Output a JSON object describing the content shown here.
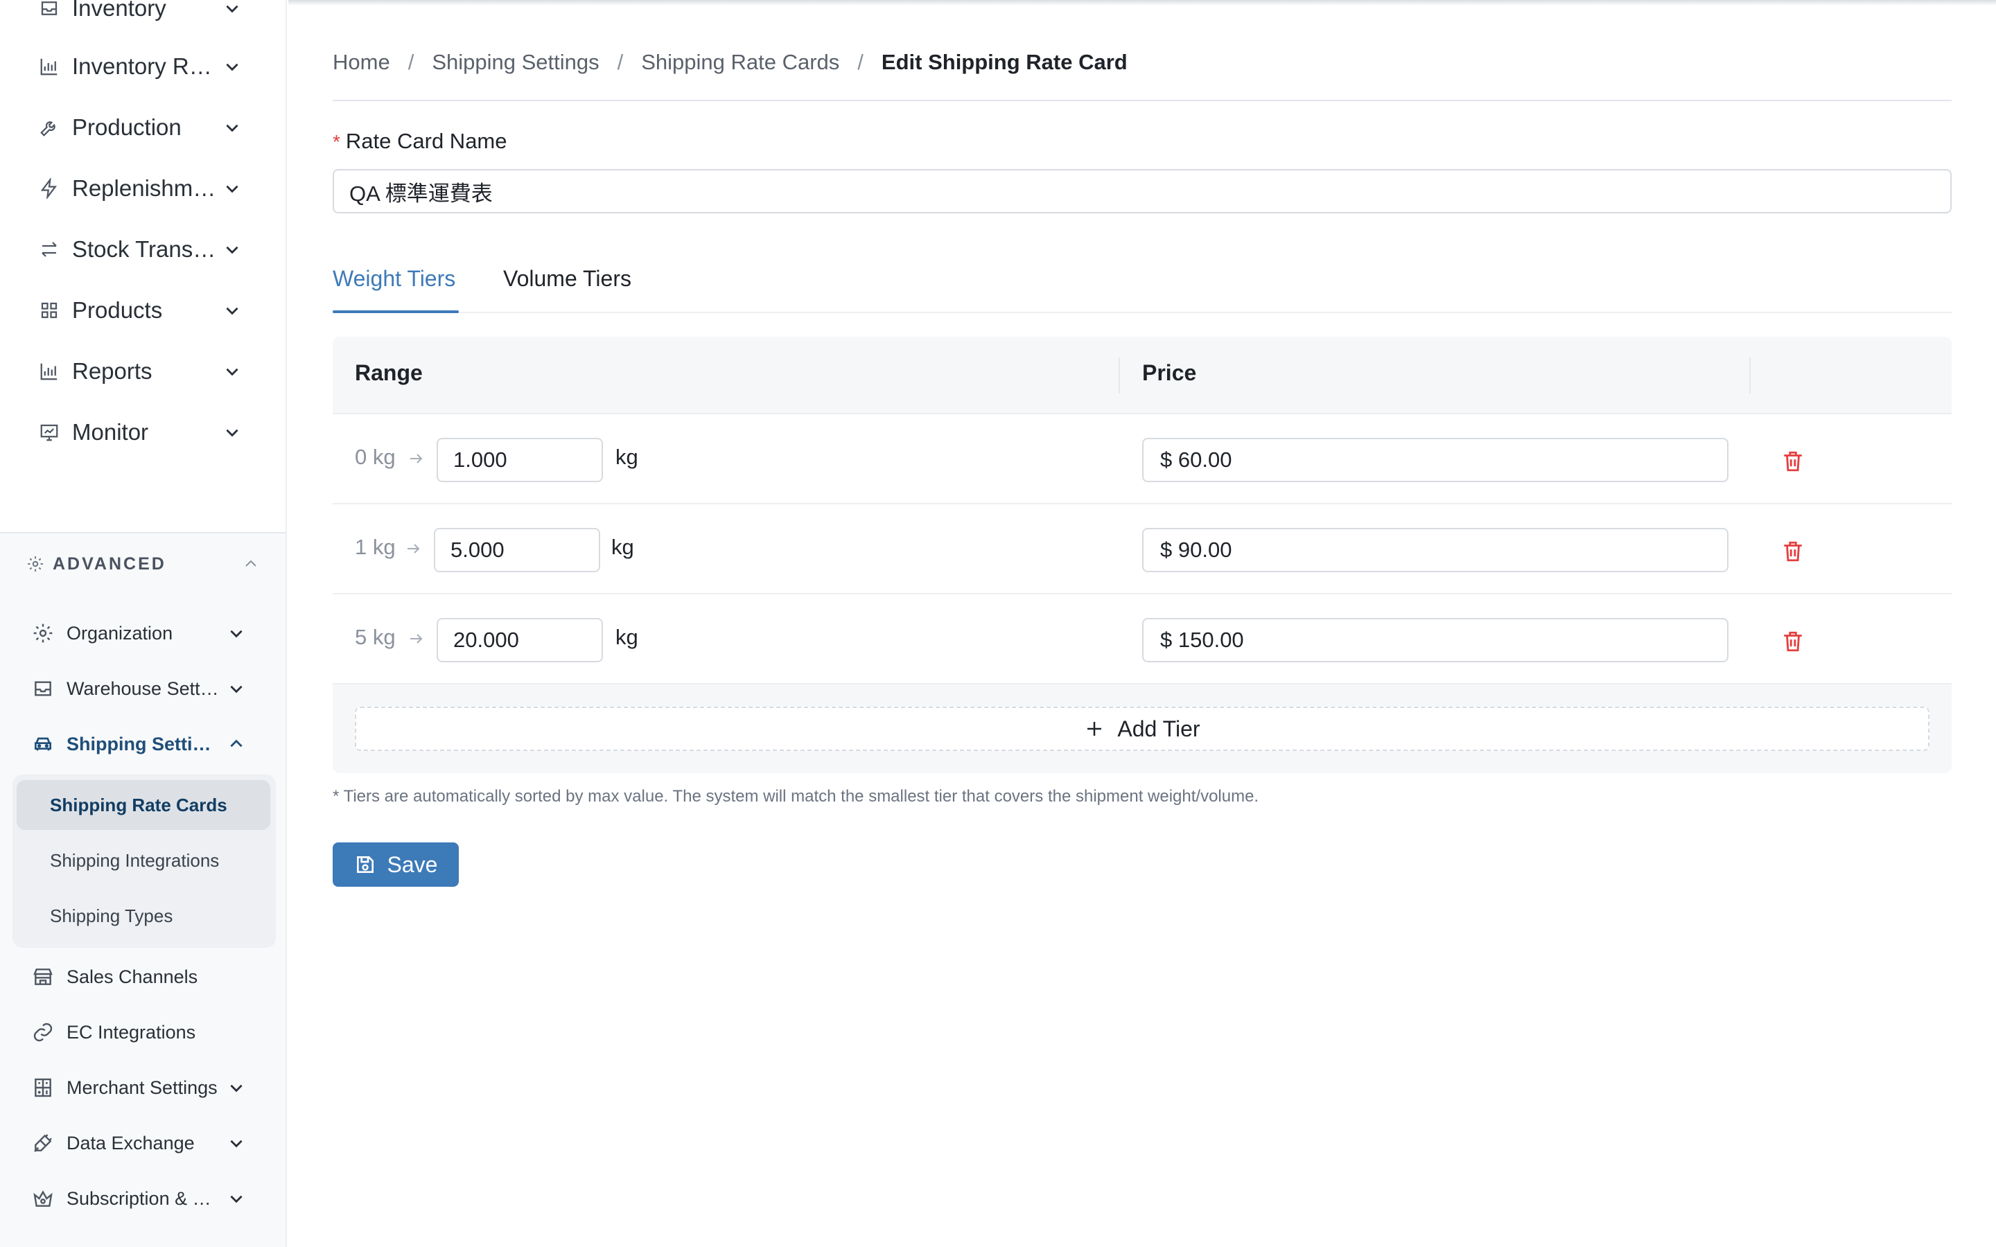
{
  "sidebar": {
    "top_items": [
      {
        "label": "Inventory",
        "icon": "inbox-icon"
      },
      {
        "label": "Inventory Reports",
        "icon": "bar-chart-icon"
      },
      {
        "label": "Production",
        "icon": "wrench-icon"
      },
      {
        "label": "Replenishment",
        "icon": "lightning-icon"
      },
      {
        "label": "Stock Transfers",
        "icon": "transfer-arrows-icon"
      },
      {
        "label": "Products",
        "icon": "grid-icon"
      },
      {
        "label": "Reports",
        "icon": "bar-chart-icon"
      },
      {
        "label": "Monitor",
        "icon": "monitor-chart-icon"
      }
    ],
    "advanced_label": "ADVANCED",
    "advanced_items": [
      {
        "label": "Organization",
        "icon": "gear-icon"
      },
      {
        "label": "Warehouse Settings",
        "icon": "inbox-icon"
      },
      {
        "label": "Shipping Settings",
        "icon": "truck-icon"
      },
      {
        "label": "Sales Channels",
        "icon": "store-icon"
      },
      {
        "label": "EC Integrations",
        "icon": "link-icon"
      },
      {
        "label": "Merchant Settings",
        "icon": "calculator-icon"
      },
      {
        "label": "Data Exchange",
        "icon": "plug-icon"
      },
      {
        "label": "Subscription & Billing",
        "icon": "crown-icon"
      }
    ],
    "shipping_children": [
      {
        "label": "Shipping Rate Cards"
      },
      {
        "label": "Shipping Integrations"
      },
      {
        "label": "Shipping Types"
      }
    ]
  },
  "breadcrumb": {
    "home": "Home",
    "level1": "Shipping Settings",
    "level2": "Shipping Rate Cards",
    "current": "Edit Shipping Rate Card",
    "separator": "/"
  },
  "form": {
    "required_mark": "*",
    "name_label": "Rate Card Name",
    "name_value": "QA 標準運費表"
  },
  "tabs": {
    "weight": "Weight Tiers",
    "volume": "Volume Tiers",
    "active": "Weight Tiers"
  },
  "table": {
    "col_range": "Range",
    "col_price": "Price",
    "rows": [
      {
        "min": "0 kg",
        "max": "1.000",
        "unit": "kg",
        "price": "$ 60.00"
      },
      {
        "min": "1 kg",
        "max": "5.000",
        "unit": "kg",
        "price": "$ 90.00"
      },
      {
        "min": "5 kg",
        "max": "20.000",
        "unit": "kg",
        "price": "$ 150.00"
      }
    ],
    "add_tier_label": "Add Tier"
  },
  "note": "* Tiers are automatically sorted by max value. The system will match the smallest tier that covers the shipment weight/volume.",
  "save_label": "Save",
  "colors": {
    "accent": "#3d7ab8",
    "danger": "#e53e3e",
    "sidebar_active": "#1f4e7a"
  }
}
